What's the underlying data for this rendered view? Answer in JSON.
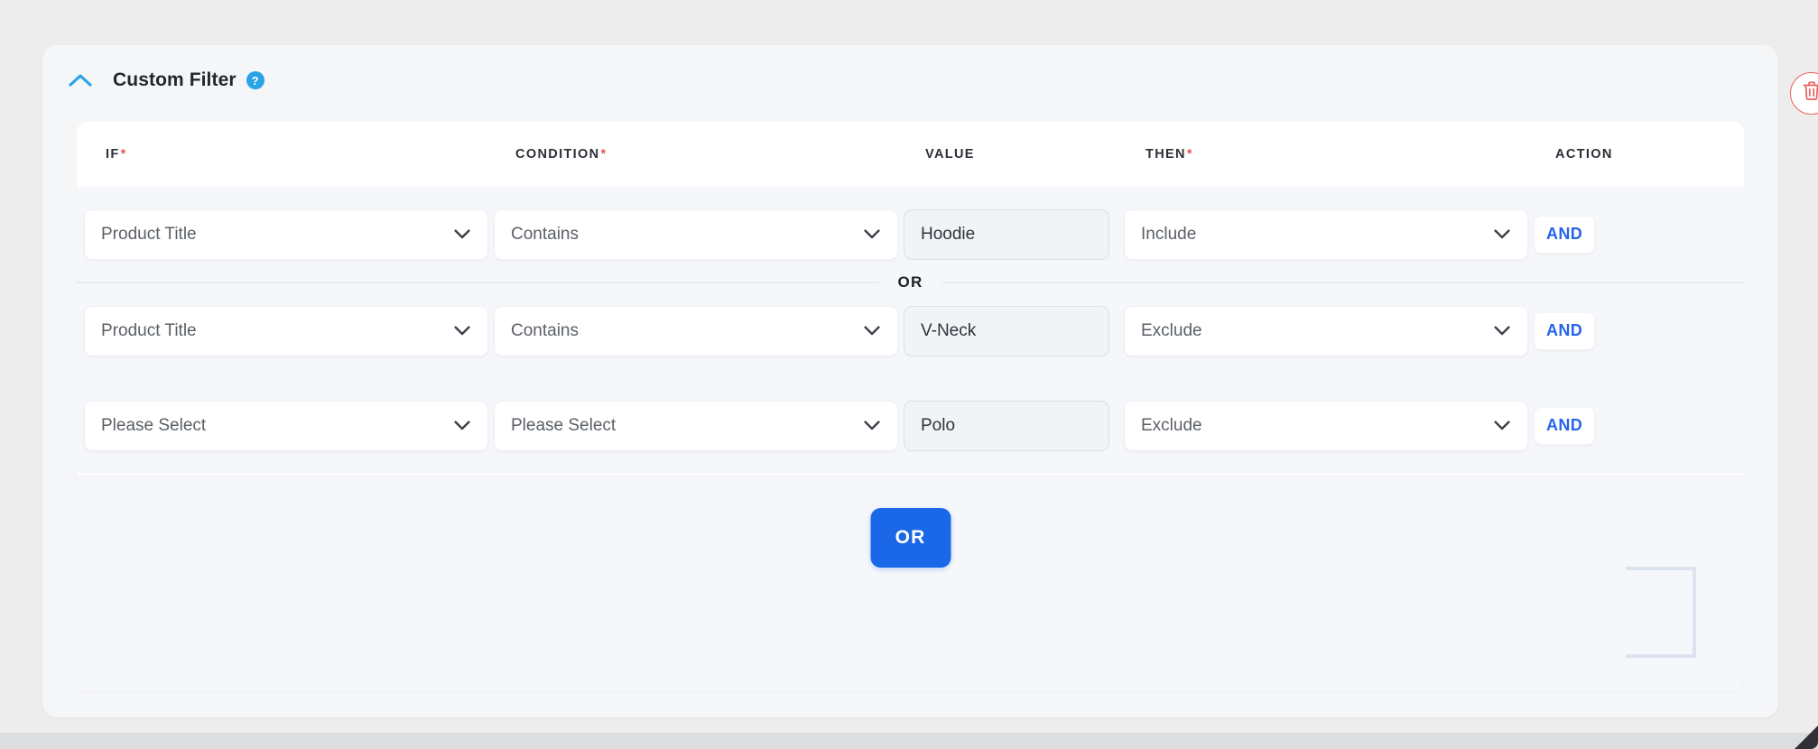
{
  "page": {
    "background_color": "#ededee"
  },
  "card": {
    "title": "Custom Filter",
    "help_badge": "?",
    "collapse_icon": "chevron-up-icon",
    "accent_color": "#29a3e8",
    "delete_icon": "trash-icon",
    "delete_color": "#e9615c"
  },
  "table": {
    "columns": [
      {
        "key": "if",
        "label": "IF",
        "required": true
      },
      {
        "key": "condition",
        "label": "CONDITION",
        "required": true
      },
      {
        "key": "value",
        "label": "VALUE",
        "required": false
      },
      {
        "key": "then",
        "label": "THEN",
        "required": true
      },
      {
        "key": "action",
        "label": "ACTION",
        "required": false
      }
    ],
    "required_marker": "*",
    "rows": [
      {
        "if": "Product Title",
        "condition": "Contains",
        "value": "Hoodie",
        "then": "Include",
        "action": "AND"
      },
      {
        "if": "Product Title",
        "condition": "Contains",
        "value": "V-Neck",
        "then": "Exclude",
        "action": "AND"
      },
      {
        "if": "Please Select",
        "condition": "Please Select",
        "value": "Polo",
        "then": "Exclude",
        "action": "AND"
      }
    ],
    "group_separator": "OR"
  },
  "footer": {
    "or_button": "OR",
    "or_button_color": "#1a68e8"
  }
}
